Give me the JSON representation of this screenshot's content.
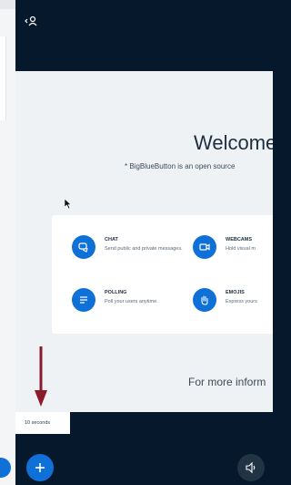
{
  "welcome": {
    "title": "Welcome",
    "subtitle": "* BigBlueButton is an open source"
  },
  "features": [
    {
      "title": "CHAT",
      "description": "Send public and private messages.",
      "icon": "chat-icon"
    },
    {
      "title": "WEBCAMS",
      "description": "Hold visual m",
      "icon": "webcam-icon"
    },
    {
      "title": "POLLING",
      "description": "Poll your users anytime.",
      "icon": "polling-icon"
    },
    {
      "title": "EMOJIS",
      "description": "Express yours",
      "icon": "emoji-hand-icon"
    }
  ],
  "footer_text": "For more inform",
  "tooltip": "10 seconds",
  "colors": {
    "primary": "#0f70d7",
    "dark_bar": "#06182b",
    "content_bg": "#eff2f5",
    "arrow": "#8b1a2b"
  }
}
